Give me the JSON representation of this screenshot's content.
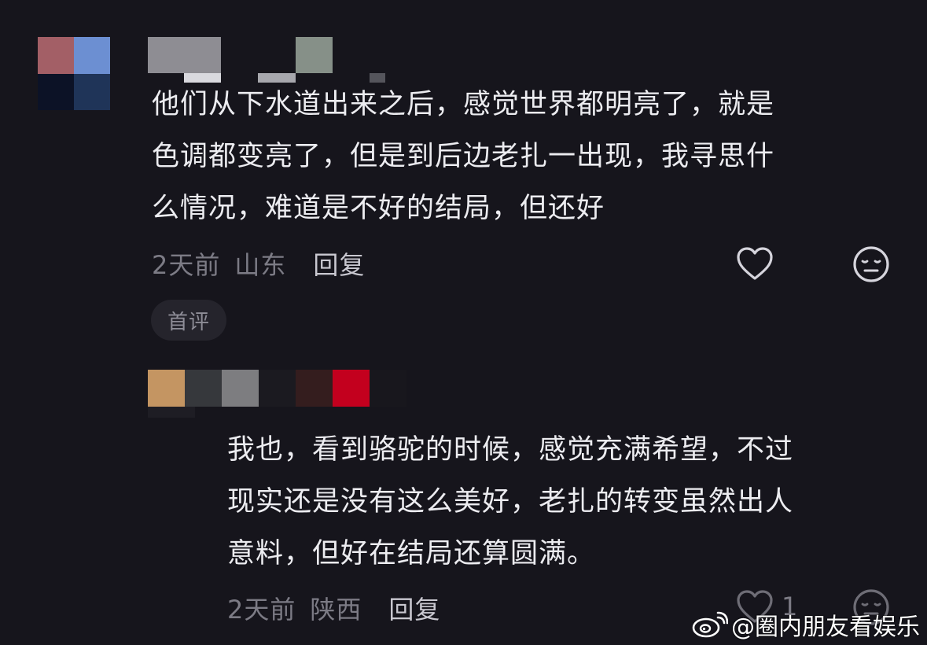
{
  "comments": [
    {
      "text": "他们从下水道出来之后，感觉世界都明亮了，就是\n色调都变亮了，但是到后边老扎一出现，我寻思什\n么情况，难道是不好的结局，但还好",
      "time": "2天前",
      "location": "山东",
      "reply_label": "回复",
      "badge": "首评"
    },
    {
      "text": "我也，看到骆驼的时候，感觉充满希望，不过\n现实还是没有这么美好，老扎的转变虽然出人\n意料，但好在结局还算圆满。",
      "time": "2天前",
      "location": "陕西",
      "reply_label": "回复",
      "like_count": "1"
    }
  ],
  "watermark": {
    "text": "@圈内朋友看娱乐",
    "icon": "weibo-icon"
  },
  "icons": {
    "like": "heart-outline-icon",
    "dislike": "neutral-face-icon"
  },
  "colors": {
    "background": "#16151c",
    "text_primary": "#ececf0",
    "text_secondary": "#7c7b85",
    "badge_bg": "#25242c"
  }
}
